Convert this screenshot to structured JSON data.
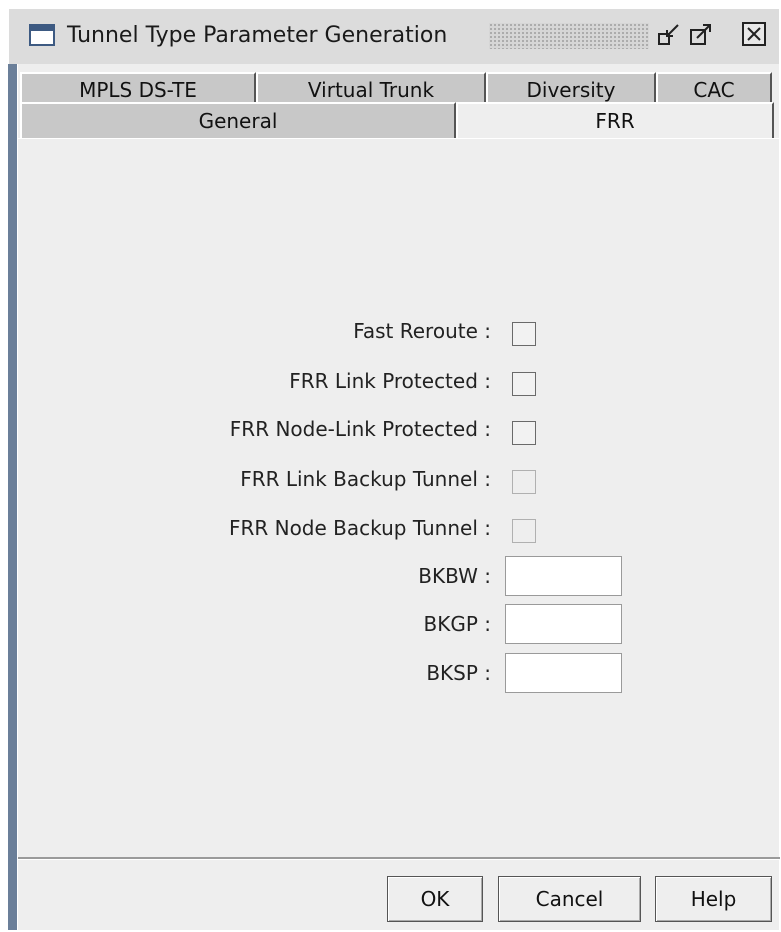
{
  "window": {
    "title": "Tunnel Type Parameter Generation"
  },
  "titlebar_icons": [
    "window-icon",
    "shrink-icon",
    "expand-icon",
    "close-icon"
  ],
  "tabs": {
    "row1": [
      {
        "label": "MPLS DS-TE"
      },
      {
        "label": "Virtual Trunk"
      },
      {
        "label": "Diversity"
      },
      {
        "label": "CAC"
      }
    ],
    "row2": [
      {
        "label": "General"
      },
      {
        "label": "FRR",
        "active": true
      }
    ]
  },
  "form": {
    "fast_reroute": {
      "label": "Fast Reroute :",
      "checked": false,
      "enabled": true
    },
    "frr_link_protected": {
      "label": "FRR Link Protected :",
      "checked": false,
      "enabled": true
    },
    "frr_node_link_protected": {
      "label": "FRR Node-Link Protected :",
      "checked": false,
      "enabled": true
    },
    "frr_link_backup_tunnel": {
      "label": "FRR Link Backup Tunnel :",
      "checked": false,
      "enabled": false
    },
    "frr_node_backup_tunnel": {
      "label": "FRR Node Backup Tunnel :",
      "checked": false,
      "enabled": false
    },
    "bkbw": {
      "label": "BKBW :",
      "value": ""
    },
    "bkgp": {
      "label": "BKGP :",
      "value": ""
    },
    "bksp": {
      "label": "BKSP :",
      "value": ""
    }
  },
  "buttons": {
    "ok": "OK",
    "cancel": "Cancel",
    "help": "Help"
  },
  "colors": {
    "frame": "#6b7f99",
    "panel": "#eeeeee",
    "tab_inactive": "#c8c8c8"
  }
}
